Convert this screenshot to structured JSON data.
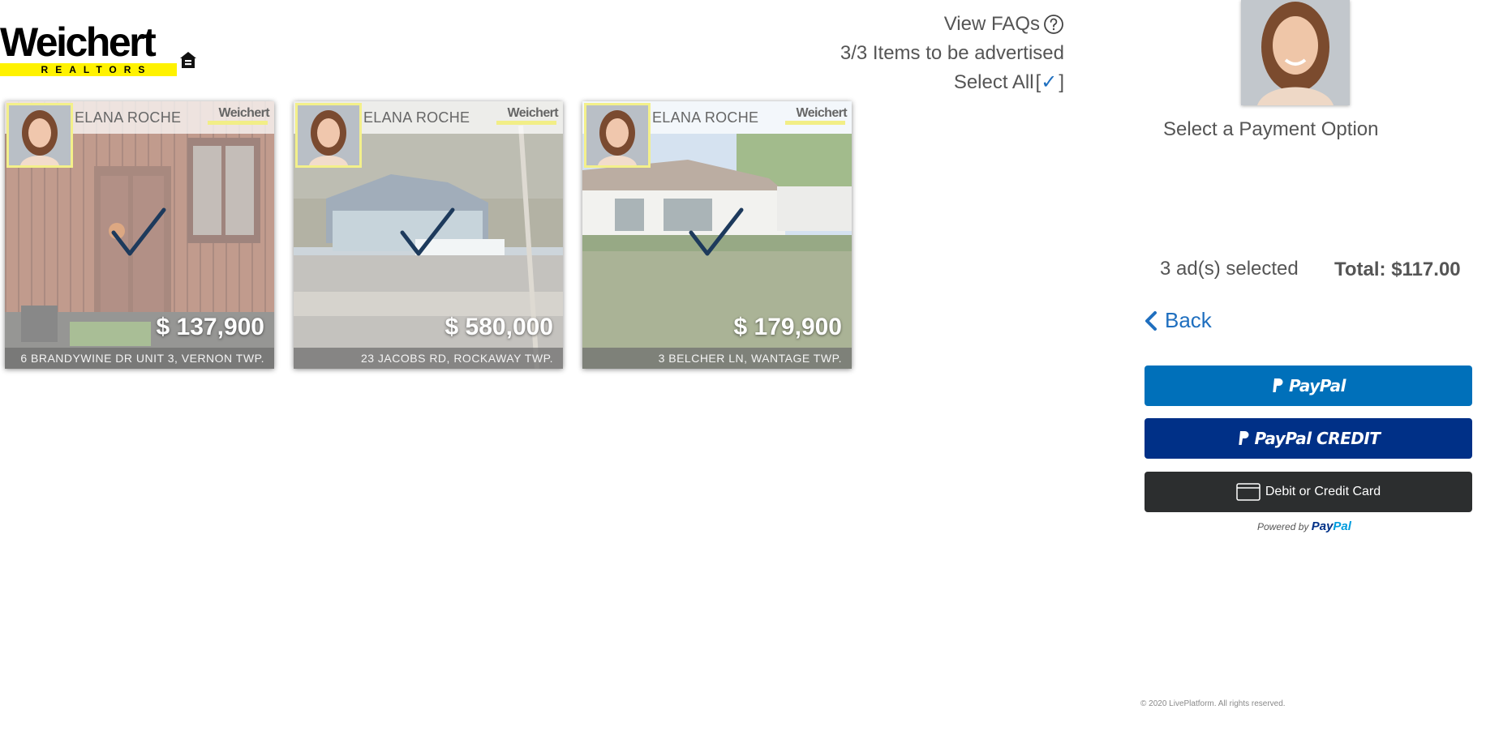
{
  "logo": {
    "brand": "Weichert",
    "tagline": "REALTORS"
  },
  "top_links": {
    "faq_label": "View FAQs",
    "items_count": "3/3 Items to be advertised",
    "select_all_label": "Select All",
    "select_all_open": "[",
    "select_all_check": "✓",
    "select_all_close": "]"
  },
  "cards": [
    {
      "agent": "ELANA ROCHE",
      "brand": "Weichert",
      "price": "$ 137,900",
      "address": "6 BRANDYWINE DR UNIT 3, VERNON TWP.",
      "selected": true
    },
    {
      "agent": "ELANA ROCHE",
      "brand": "Weichert",
      "price": "$ 580,000",
      "address": "23 JACOBS RD, ROCKAWAY TWP.",
      "selected": true
    },
    {
      "agent": "ELANA ROCHE",
      "brand": "Weichert",
      "price": "$ 179,900",
      "address": "3 BELCHER LN, WANTAGE TWP.",
      "selected": true
    }
  ],
  "payment": {
    "title": "Select a Payment Option",
    "selected_count": "3 ad(s) selected",
    "total": "Total: $117.00",
    "back_label": "Back",
    "paypal_label": "PayPal",
    "paypal_credit_label": "PayPal CREDIT",
    "card_label": "Debit or Credit Card",
    "powered_by": "Powered by",
    "powered_brand_1": "Pay",
    "powered_brand_2": "Pal"
  },
  "footer": {
    "copyright": "© 2020 LivePlatform. All rights reserved."
  },
  "colors": {
    "paypal_blue": "#0070ba",
    "paypal_credit": "#003087",
    "card_button": "#2c2e2f",
    "link_blue": "#1f6fbf",
    "logo_yellow": "#fff200",
    "check_navy": "#1d3a5c"
  },
  "icons": {
    "faq": "question-circle-icon",
    "back": "chevron-left-icon",
    "paypal": "paypal-p-icon",
    "card": "credit-card-icon",
    "check": "checkmark-icon",
    "eho": "equal-housing-icon"
  }
}
